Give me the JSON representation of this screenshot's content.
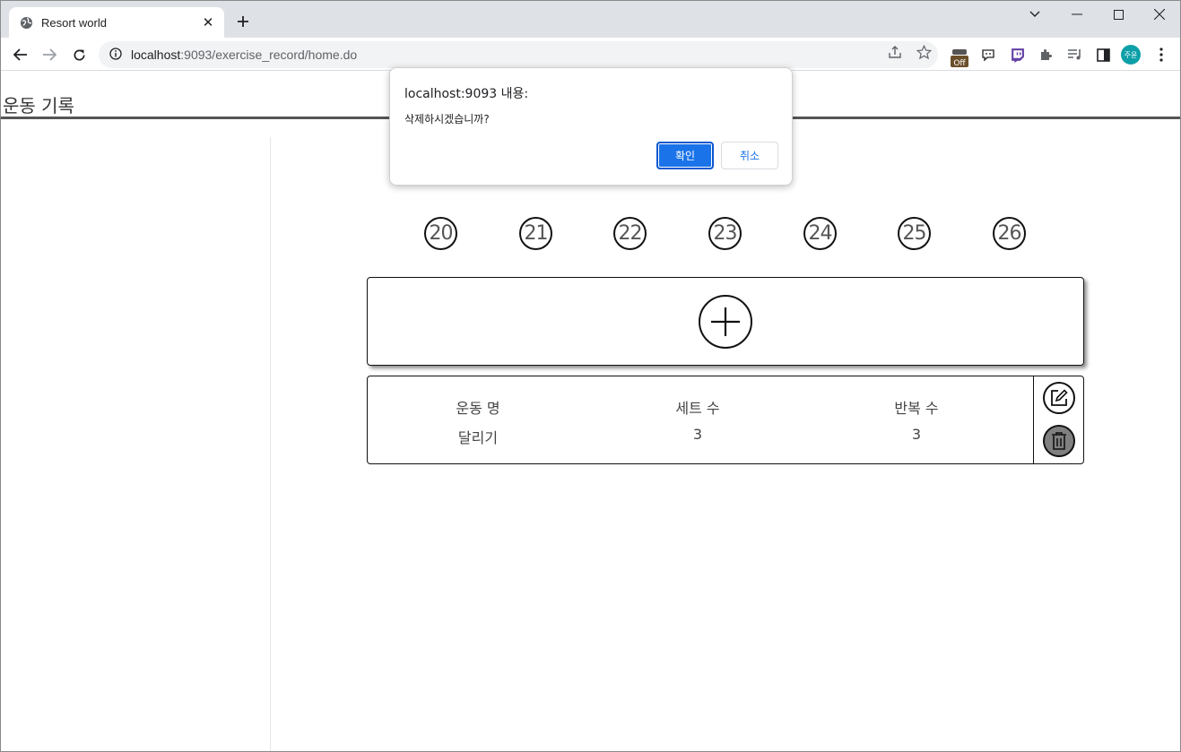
{
  "browser": {
    "tab_title": "Resort world",
    "tab_close": "✕",
    "url_host": "localhost",
    "url_rest": ":9093/exercise_record/home.do",
    "profile_initials": "주윤",
    "extension_badge": "Off"
  },
  "page": {
    "title": "운동 기록",
    "days": [
      "20",
      "21",
      "22",
      "23",
      "24",
      "25",
      "26"
    ],
    "record": {
      "columns": [
        "운동 명",
        "세트 수",
        "반복 수"
      ],
      "values": [
        "달리기",
        "3",
        "3"
      ]
    }
  },
  "dialog": {
    "title": "localhost:9093 내용:",
    "message": "삭제하시겠습니까?",
    "ok_label": "확인",
    "cancel_label": "취소"
  },
  "colors": {
    "accent": "#1a73e8",
    "tabstrip": "#dee1e6",
    "avatar": "#0d9fa8"
  }
}
